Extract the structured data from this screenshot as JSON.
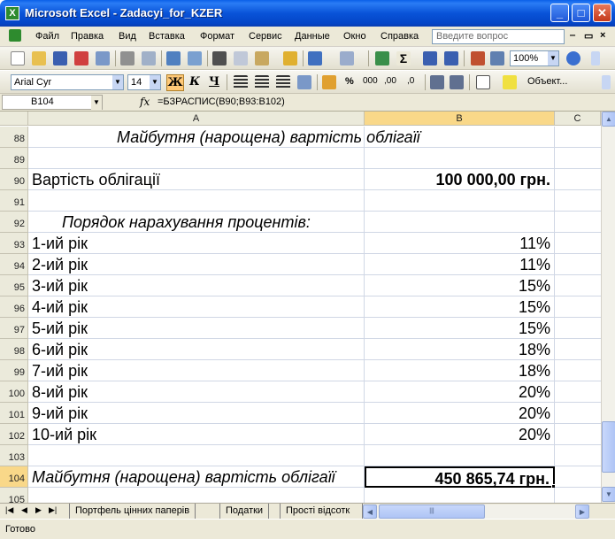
{
  "window": {
    "title": "Microsoft Excel - Zadacyi_for_KZER",
    "minimize_label": "_",
    "maximize_label": "□",
    "close_label": "✕"
  },
  "menu": {
    "items": [
      "Файл",
      "Правка",
      "Вид",
      "Вставка",
      "Формат",
      "Сервис",
      "Данные",
      "Окно",
      "Справка"
    ],
    "help_placeholder": "Введите вопрос"
  },
  "toolbar": {
    "zoom": "100%",
    "font_name": "Arial Cyr",
    "font_size": "14",
    "bold_label": "Ж",
    "italic_label": "К",
    "underline_label": "Ч",
    "percent_label": "%",
    "thousands_label": "000",
    "inc_decimals_label": ",00",
    "dec_decimals_label": ",0",
    "objects_label": "Объект..."
  },
  "formula_bar": {
    "name_box": "B104",
    "fx": "fx",
    "formula": "=БЗРАСПИС(B90;B93:B102)"
  },
  "columns": [
    "A",
    "B",
    "C"
  ],
  "rows": [
    {
      "num": "88",
      "a": "Майбутня (нарощена) вартість  облігаїї",
      "b": ""
    },
    {
      "num": "89",
      "a": "",
      "b": ""
    },
    {
      "num": "90",
      "a": "Вартість облігації",
      "b": "100 000,00 грн."
    },
    {
      "num": "91",
      "a": "",
      "b": ""
    },
    {
      "num": "92",
      "a": "Порядок нарахування процентів:",
      "b": ""
    },
    {
      "num": "93",
      "a": "1-ий рік",
      "b": "11%"
    },
    {
      "num": "94",
      "a": "2-ий рік",
      "b": "11%"
    },
    {
      "num": "95",
      "a": "3-ий рік",
      "b": "15%"
    },
    {
      "num": "96",
      "a": "4-ий рік",
      "b": "15%"
    },
    {
      "num": "97",
      "a": "5-ий рік",
      "b": "15%"
    },
    {
      "num": "98",
      "a": "6-ий рік",
      "b": "18%"
    },
    {
      "num": "99",
      "a": "7-ий рік",
      "b": "18%"
    },
    {
      "num": "100",
      "a": "8-ий рік",
      "b": "20%"
    },
    {
      "num": "101",
      "a": "9-ий рік",
      "b": "20%"
    },
    {
      "num": "102",
      "a": "10-ий рік",
      "b": "20%"
    },
    {
      "num": "103",
      "a": "",
      "b": ""
    },
    {
      "num": "104",
      "a": "Майбутня (нарощена) вартість  облігаїї",
      "b": "450 865,74 грн."
    },
    {
      "num": "105",
      "a": "",
      "b": ""
    }
  ],
  "sheet_tabs": [
    "Портфель цінних паперів",
    "Податки",
    "Прості відсотк"
  ],
  "status": "Готово"
}
